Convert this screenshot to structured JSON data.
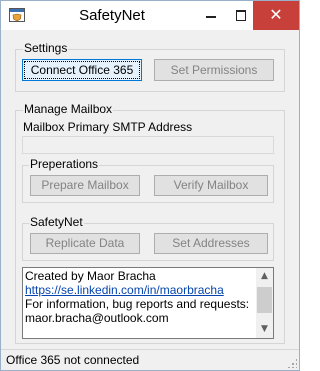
{
  "window": {
    "title": "SafetyNet",
    "close_glyph": "✕"
  },
  "settings": {
    "group_label": "Settings",
    "connect_button": "Connect Office 365",
    "set_permissions_button": "Set Permissions"
  },
  "manage_mailbox": {
    "group_label": "Manage Mailbox",
    "smtp_label": "Mailbox Primary SMTP Address",
    "smtp_value": ""
  },
  "preperations": {
    "group_label": "Preperations",
    "prepare_button": "Prepare Mailbox",
    "verify_button": "Verify Mailbox"
  },
  "safetynet": {
    "group_label": "SafetyNet",
    "replicate_button": "Replicate Data",
    "set_addresses_button": "Set Addresses"
  },
  "info": {
    "line1": "Created by Maor Bracha",
    "link": "https://se.linkedin.com/in/maorbracha",
    "line3": "For information, bug reports and requests:",
    "line4": "maor.bracha@outlook.com",
    "scroll_up_glyph": "▲",
    "scroll_down_glyph": "▼"
  },
  "status": {
    "text": "Office 365 not connected"
  },
  "icons": {
    "app": "shield-icon",
    "minimize": "minimize-icon",
    "maximize": "maximize-icon",
    "close": "close-icon"
  }
}
